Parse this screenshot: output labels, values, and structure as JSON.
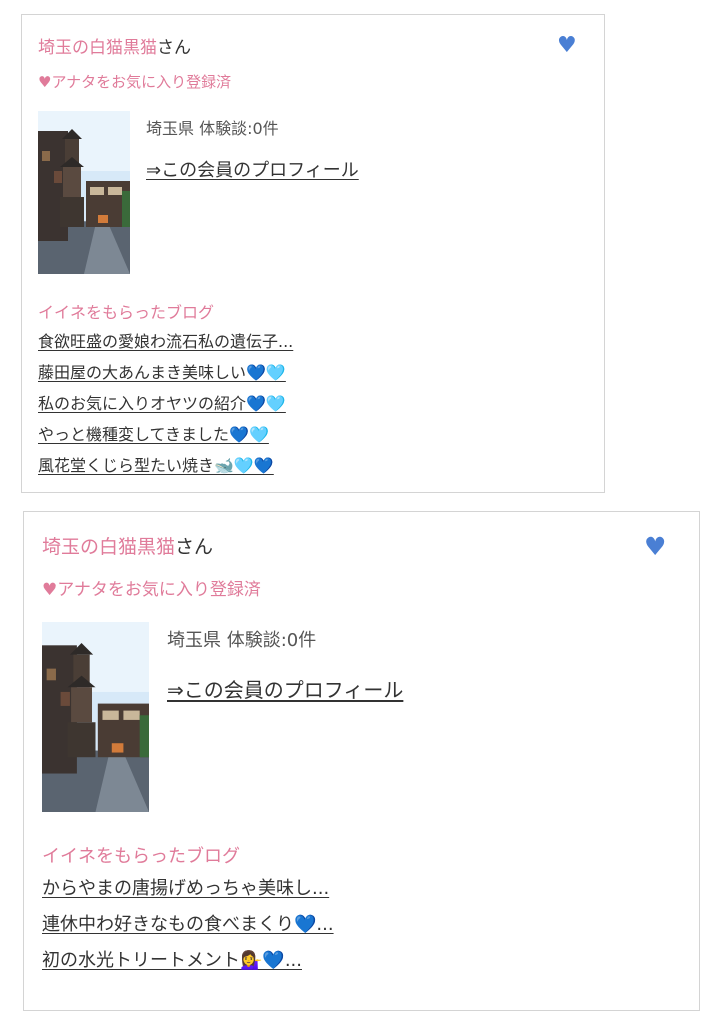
{
  "colors": {
    "accent_pink": "#e07b9a",
    "heart_blue": "#4a7fd4",
    "border": "#d4d4d4"
  },
  "cards": [
    {
      "member_name": "埼玉の白猫黒猫",
      "name_suffix": "さん",
      "favorite_icon": "heart-icon",
      "favorite_status": "♥アナタをお気に入り登録済",
      "photo": "street-photo",
      "meta": "埼玉県  体験談:0件",
      "profile_link": "⇒この会員のプロフィール",
      "blog_heading": "イイネをもらったブログ",
      "blogs": [
        "食欲旺盛の愛娘わ流石私の遺伝子...",
        "藤田屋の大あんまき美味しい💙🩵",
        "私のお気に入りオヤツの紹介💙🩵",
        "やっと機種変してきました💙🩵",
        "風花堂くじら型たい焼き🐋🩵💙"
      ]
    },
    {
      "member_name": "埼玉の白猫黒猫",
      "name_suffix": "さん",
      "favorite_icon": "heart-icon",
      "favorite_status": "♥アナタをお気に入り登録済",
      "photo": "street-photo",
      "meta": "埼玉県  体験談:0件",
      "profile_link": "⇒この会員のプロフィール",
      "blog_heading": "イイネをもらったブログ",
      "blogs": [
        "からやまの唐揚げめっちゃ美味し...",
        "連休中わ好きなもの食べまくり💙...",
        "初の水光トリートメント💁‍♀️💙..."
      ]
    }
  ]
}
